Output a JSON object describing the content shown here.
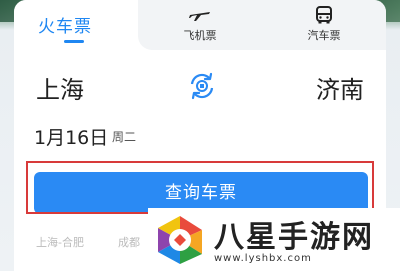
{
  "tabs": [
    {
      "label": "火车票",
      "active": true
    },
    {
      "label": "飞机票",
      "icon": "airplane-icon"
    },
    {
      "label": "汽车票",
      "icon": "bus-icon"
    }
  ],
  "route": {
    "from": "上海",
    "to": "济南",
    "swap_icon": "swap-icon"
  },
  "date": {
    "value": "1月16日",
    "weekday": "周二"
  },
  "search_button": {
    "label": "查询车票"
  },
  "history": [
    "上海-合肥",
    "成都"
  ],
  "watermark": {
    "title": "八星手游网",
    "url": "www.lyshbx.com"
  },
  "colors": {
    "accent": "#1f87f2",
    "button": "#2a8af4",
    "highlight_border": "#d83a3a"
  }
}
